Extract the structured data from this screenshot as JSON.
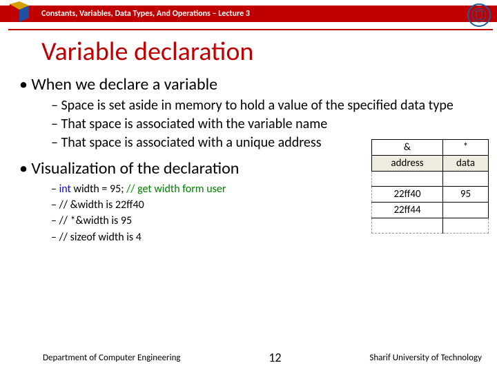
{
  "header": {
    "breadcrumb": "Constants, Variables, Data Types, And Operations – Lecture 3"
  },
  "title": "Variable declaration",
  "bullets": {
    "b1": "When we declare a variable",
    "b1sub": [
      "Space is set aside in memory to hold a value of the specified data type",
      "That space is associated with the variable name",
      "That space is associated with a unique address"
    ],
    "b2": "Visualization of the declaration",
    "b2sub": {
      "line1_kw": "int",
      "line1_rest": " width = 95;  ",
      "line1_comment": "// get width form user",
      "line2": "//  &width is 22ff40",
      "line3": "// *&width is 95",
      "line4": "// sizeof width is 4"
    }
  },
  "table": {
    "top1": "&",
    "top2": "*",
    "h1": "address",
    "h2": "data",
    "r1a": "22ff40",
    "r1b": "95",
    "r2a": "22ff44",
    "r2b": ""
  },
  "footer": {
    "left": "Department of Computer Engineering",
    "page": "12",
    "right": "Sharif University of Technology"
  }
}
